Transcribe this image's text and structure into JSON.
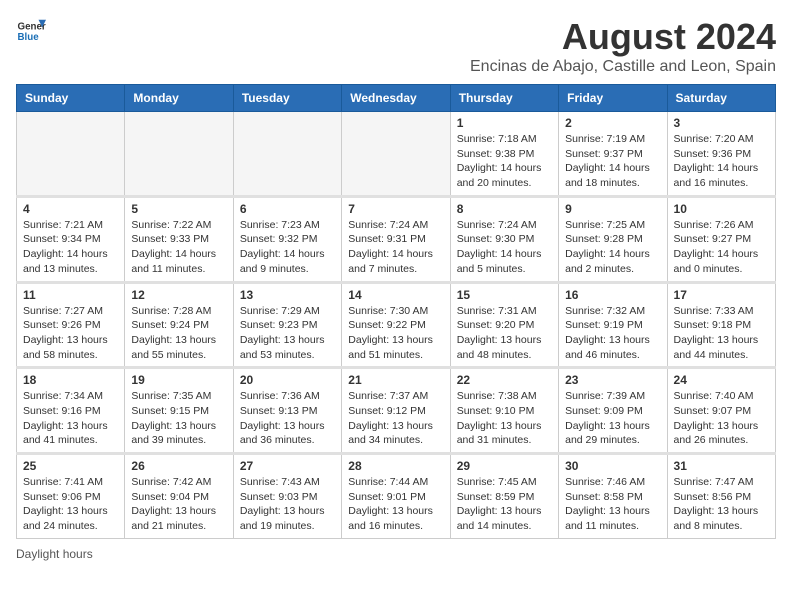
{
  "logo": {
    "text_general": "General",
    "text_blue": "Blue"
  },
  "title": "August 2024",
  "subtitle": "Encinas de Abajo, Castille and Leon, Spain",
  "days_header": [
    "Sunday",
    "Monday",
    "Tuesday",
    "Wednesday",
    "Thursday",
    "Friday",
    "Saturday"
  ],
  "footer": "Daylight hours",
  "weeks": [
    [
      {
        "day": "",
        "info": ""
      },
      {
        "day": "",
        "info": ""
      },
      {
        "day": "",
        "info": ""
      },
      {
        "day": "",
        "info": ""
      },
      {
        "day": "1",
        "info": "Sunrise: 7:18 AM\nSunset: 9:38 PM\nDaylight: 14 hours\nand 20 minutes."
      },
      {
        "day": "2",
        "info": "Sunrise: 7:19 AM\nSunset: 9:37 PM\nDaylight: 14 hours\nand 18 minutes."
      },
      {
        "day": "3",
        "info": "Sunrise: 7:20 AM\nSunset: 9:36 PM\nDaylight: 14 hours\nand 16 minutes."
      }
    ],
    [
      {
        "day": "4",
        "info": "Sunrise: 7:21 AM\nSunset: 9:34 PM\nDaylight: 14 hours\nand 13 minutes."
      },
      {
        "day": "5",
        "info": "Sunrise: 7:22 AM\nSunset: 9:33 PM\nDaylight: 14 hours\nand 11 minutes."
      },
      {
        "day": "6",
        "info": "Sunrise: 7:23 AM\nSunset: 9:32 PM\nDaylight: 14 hours\nand 9 minutes."
      },
      {
        "day": "7",
        "info": "Sunrise: 7:24 AM\nSunset: 9:31 PM\nDaylight: 14 hours\nand 7 minutes."
      },
      {
        "day": "8",
        "info": "Sunrise: 7:24 AM\nSunset: 9:30 PM\nDaylight: 14 hours\nand 5 minutes."
      },
      {
        "day": "9",
        "info": "Sunrise: 7:25 AM\nSunset: 9:28 PM\nDaylight: 14 hours\nand 2 minutes."
      },
      {
        "day": "10",
        "info": "Sunrise: 7:26 AM\nSunset: 9:27 PM\nDaylight: 14 hours\nand 0 minutes."
      }
    ],
    [
      {
        "day": "11",
        "info": "Sunrise: 7:27 AM\nSunset: 9:26 PM\nDaylight: 13 hours\nand 58 minutes."
      },
      {
        "day": "12",
        "info": "Sunrise: 7:28 AM\nSunset: 9:24 PM\nDaylight: 13 hours\nand 55 minutes."
      },
      {
        "day": "13",
        "info": "Sunrise: 7:29 AM\nSunset: 9:23 PM\nDaylight: 13 hours\nand 53 minutes."
      },
      {
        "day": "14",
        "info": "Sunrise: 7:30 AM\nSunset: 9:22 PM\nDaylight: 13 hours\nand 51 minutes."
      },
      {
        "day": "15",
        "info": "Sunrise: 7:31 AM\nSunset: 9:20 PM\nDaylight: 13 hours\nand 48 minutes."
      },
      {
        "day": "16",
        "info": "Sunrise: 7:32 AM\nSunset: 9:19 PM\nDaylight: 13 hours\nand 46 minutes."
      },
      {
        "day": "17",
        "info": "Sunrise: 7:33 AM\nSunset: 9:18 PM\nDaylight: 13 hours\nand 44 minutes."
      }
    ],
    [
      {
        "day": "18",
        "info": "Sunrise: 7:34 AM\nSunset: 9:16 PM\nDaylight: 13 hours\nand 41 minutes."
      },
      {
        "day": "19",
        "info": "Sunrise: 7:35 AM\nSunset: 9:15 PM\nDaylight: 13 hours\nand 39 minutes."
      },
      {
        "day": "20",
        "info": "Sunrise: 7:36 AM\nSunset: 9:13 PM\nDaylight: 13 hours\nand 36 minutes."
      },
      {
        "day": "21",
        "info": "Sunrise: 7:37 AM\nSunset: 9:12 PM\nDaylight: 13 hours\nand 34 minutes."
      },
      {
        "day": "22",
        "info": "Sunrise: 7:38 AM\nSunset: 9:10 PM\nDaylight: 13 hours\nand 31 minutes."
      },
      {
        "day": "23",
        "info": "Sunrise: 7:39 AM\nSunset: 9:09 PM\nDaylight: 13 hours\nand 29 minutes."
      },
      {
        "day": "24",
        "info": "Sunrise: 7:40 AM\nSunset: 9:07 PM\nDaylight: 13 hours\nand 26 minutes."
      }
    ],
    [
      {
        "day": "25",
        "info": "Sunrise: 7:41 AM\nSunset: 9:06 PM\nDaylight: 13 hours\nand 24 minutes."
      },
      {
        "day": "26",
        "info": "Sunrise: 7:42 AM\nSunset: 9:04 PM\nDaylight: 13 hours\nand 21 minutes."
      },
      {
        "day": "27",
        "info": "Sunrise: 7:43 AM\nSunset: 9:03 PM\nDaylight: 13 hours\nand 19 minutes."
      },
      {
        "day": "28",
        "info": "Sunrise: 7:44 AM\nSunset: 9:01 PM\nDaylight: 13 hours\nand 16 minutes."
      },
      {
        "day": "29",
        "info": "Sunrise: 7:45 AM\nSunset: 8:59 PM\nDaylight: 13 hours\nand 14 minutes."
      },
      {
        "day": "30",
        "info": "Sunrise: 7:46 AM\nSunset: 8:58 PM\nDaylight: 13 hours\nand 11 minutes."
      },
      {
        "day": "31",
        "info": "Sunrise: 7:47 AM\nSunset: 8:56 PM\nDaylight: 13 hours\nand 8 minutes."
      }
    ]
  ]
}
